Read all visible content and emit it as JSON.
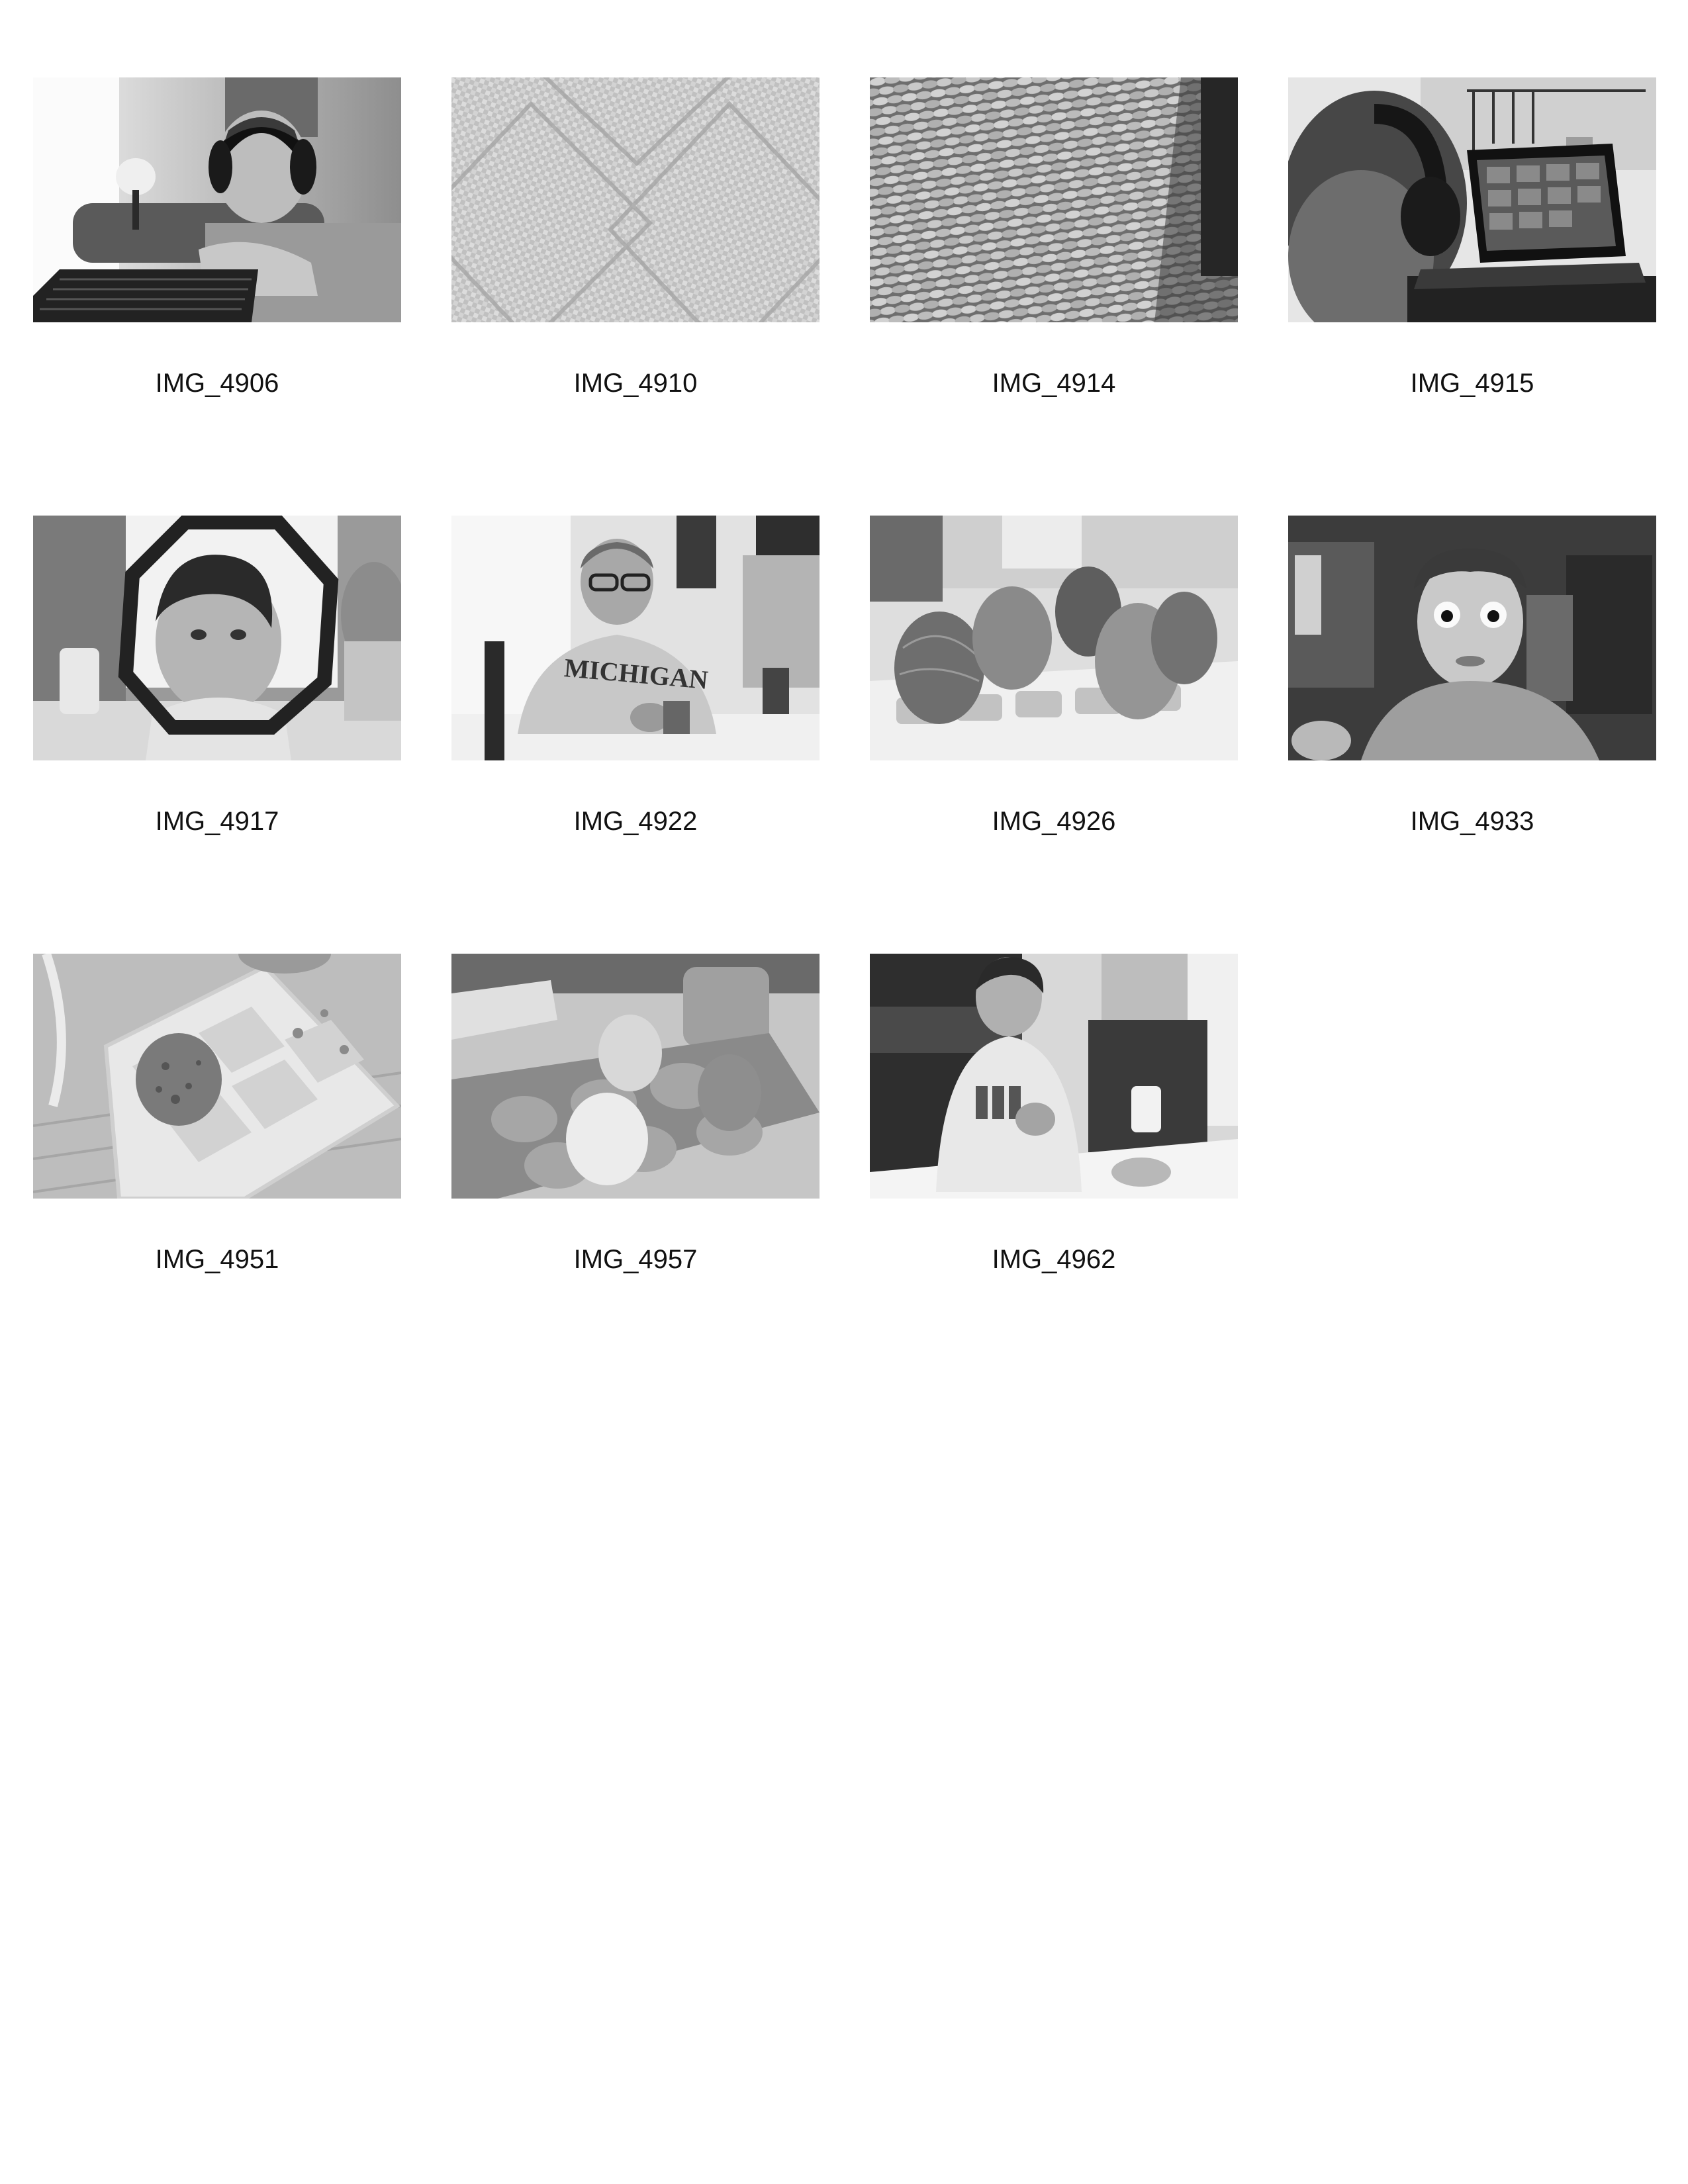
{
  "contact_sheet": {
    "photos": [
      {
        "name": "IMG_4906",
        "scene": "boy-headphones-laptop"
      },
      {
        "name": "IMG_4910",
        "scene": "quilted-fabric-texture"
      },
      {
        "name": "IMG_4914",
        "scene": "woven-basket-texture"
      },
      {
        "name": "IMG_4915",
        "scene": "boy-headphones-monitor"
      },
      {
        "name": "IMG_4917",
        "scene": "boy-through-ring"
      },
      {
        "name": "IMG_4922",
        "scene": "man-michigan-sweatshirt"
      },
      {
        "name": "IMG_4926",
        "scene": "dyed-eggs-tray"
      },
      {
        "name": "IMG_4933",
        "scene": "boy-funny-face"
      },
      {
        "name": "IMG_4951",
        "scene": "egg-in-paint-tray"
      },
      {
        "name": "IMG_4957",
        "scene": "eggs-in-carton"
      },
      {
        "name": "IMG_4962",
        "scene": "boy-dyeing-egg"
      }
    ]
  },
  "colors": {
    "background": "#ffffff",
    "caption_text": "#111111"
  }
}
